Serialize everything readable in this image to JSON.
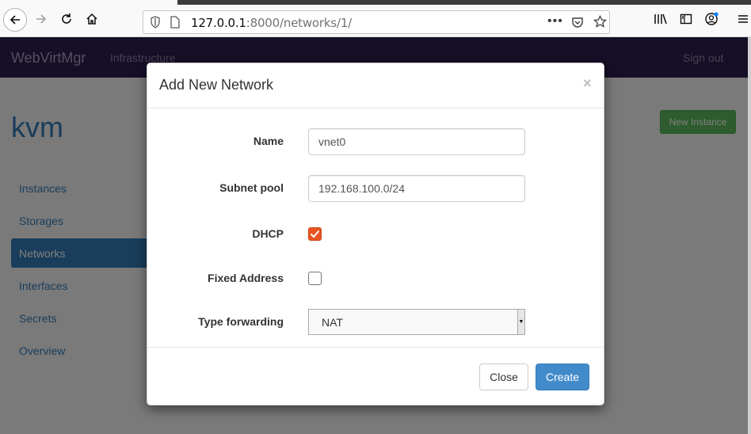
{
  "browser": {
    "url_host": "127.0.0.1",
    "url_path": ":8000/networks/1/",
    "icons": [
      "back-arrow-icon",
      "forward-arrow-icon",
      "reload-icon",
      "home-icon",
      "shield-icon",
      "page-icon",
      "more-icon",
      "pocket-icon",
      "star-icon",
      "library-icon",
      "sidebar-icon",
      "account-icon",
      "menu-icon"
    ]
  },
  "navbar": {
    "brand": "WebVirtMgr",
    "link_infrastructure": "Infrastructure",
    "sign_out": "Sign out",
    "color": "#2f1d4f"
  },
  "page": {
    "host_title": "kvm",
    "new_instance_label": "New Instance",
    "sidebar": [
      {
        "label": "Instances",
        "active": false
      },
      {
        "label": "Storages",
        "active": false
      },
      {
        "label": "Networks",
        "active": true
      },
      {
        "label": "Interfaces",
        "active": false
      },
      {
        "label": "Secrets",
        "active": false
      },
      {
        "label": "Overview",
        "active": false
      }
    ]
  },
  "modal": {
    "title": "Add New Network",
    "close_symbol": "×",
    "fields": {
      "name_label": "Name",
      "name_value": "vnet0",
      "subnet_label": "Subnet pool",
      "subnet_value": "192.168.100.0/24",
      "dhcp_label": "DHCP",
      "dhcp_checked": true,
      "fixed_label": "Fixed Address",
      "fixed_checked": false,
      "forward_label": "Type forwarding",
      "forward_value": "NAT"
    },
    "close_button": "Close",
    "create_button": "Create",
    "accent_color": "#e95420",
    "primary_color": "#428bca"
  }
}
